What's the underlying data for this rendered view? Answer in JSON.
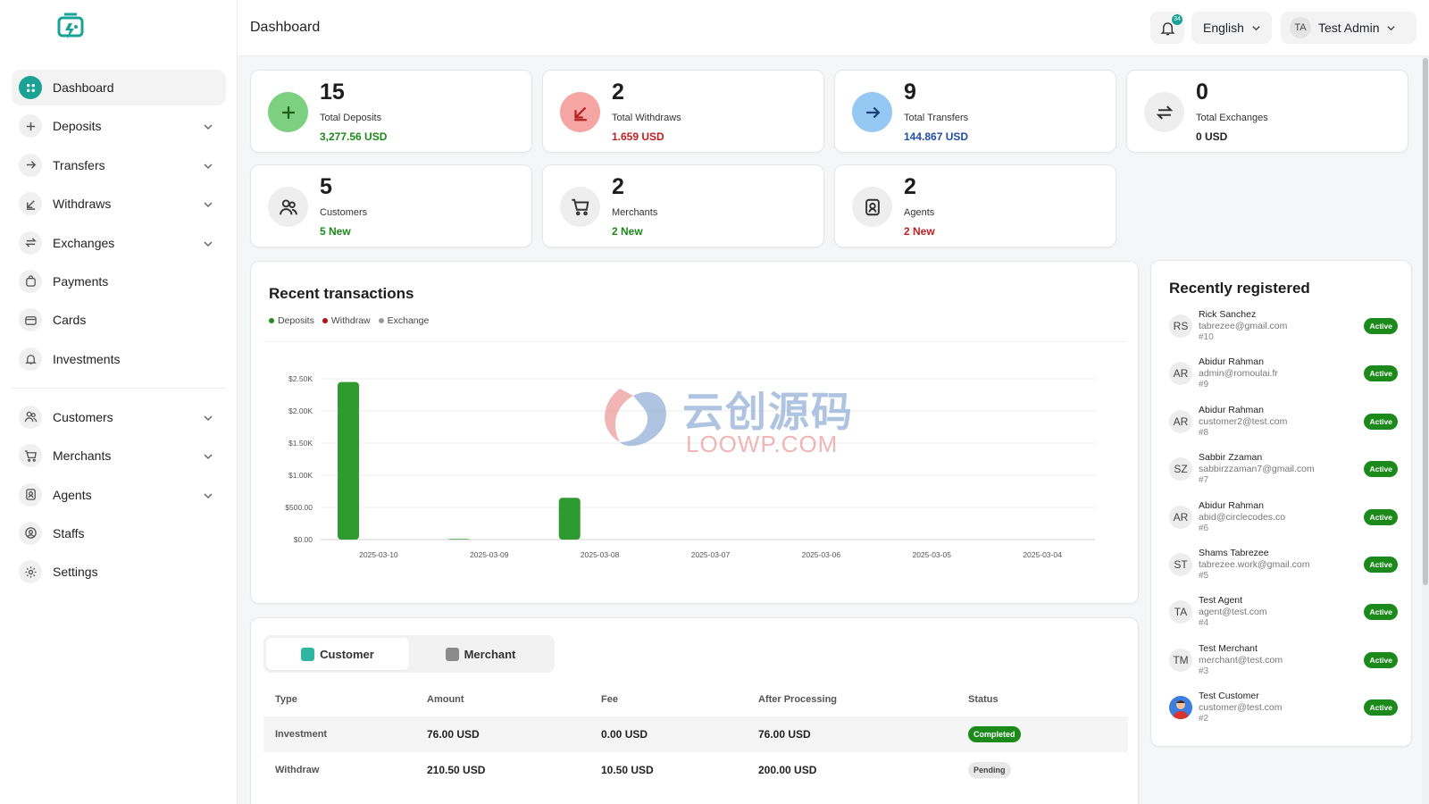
{
  "topbar": {
    "title": "Dashboard",
    "notifications_count": "34",
    "language": "English",
    "user_initials": "TA",
    "user_name": "Test Admin"
  },
  "sidebar": {
    "items": [
      {
        "label": "Dashboard",
        "icon": "grid-icon",
        "active": true
      },
      {
        "label": "Deposits",
        "icon": "plus-icon",
        "has_children": true
      },
      {
        "label": "Transfers",
        "icon": "arrow-right-icon",
        "has_children": true
      },
      {
        "label": "Withdraws",
        "icon": "arrow-down-left-icon",
        "has_children": true
      },
      {
        "label": "Exchanges",
        "icon": "exchange-icon",
        "has_children": true
      },
      {
        "label": "Payments",
        "icon": "bag-icon"
      },
      {
        "label": "Cards",
        "icon": "card-icon"
      },
      {
        "label": "Investments",
        "icon": "bell-icon"
      }
    ],
    "items2": [
      {
        "label": "Customers",
        "icon": "users-icon",
        "has_children": true
      },
      {
        "label": "Merchants",
        "icon": "cart-icon",
        "has_children": true
      },
      {
        "label": "Agents",
        "icon": "badge-icon",
        "has_children": true
      },
      {
        "label": "Staffs",
        "icon": "user-circle-icon"
      },
      {
        "label": "Settings",
        "icon": "gear-icon"
      }
    ]
  },
  "stats": [
    {
      "number": "15",
      "label": "Total Deposits",
      "sub": "3,277.56 USD",
      "sub_color": "#1b8a1b",
      "icon": "plus-icon",
      "icon_bg": "#7dd07f",
      "icon_color": "#1a5e1a"
    },
    {
      "number": "2",
      "label": "Total Withdraws",
      "sub": "1.659 USD",
      "sub_color": "#c0201f",
      "icon": "arrow-down-left-icon",
      "icon_bg": "#f6a5a5",
      "icon_color": "#b3201f"
    },
    {
      "number": "9",
      "label": "Total Transfers",
      "sub": "144.867 USD",
      "sub_color": "#1f4fa3",
      "icon": "arrow-right-icon",
      "icon_bg": "#95c8f3",
      "icon_color": "#1d3f7a"
    },
    {
      "number": "0",
      "label": "Total Exchanges",
      "sub": "0 USD",
      "sub_color": "#222222",
      "icon": "exchange-icon",
      "icon_bg": "#eeeeee",
      "icon_color": "#333333"
    },
    {
      "number": "5",
      "label": "Customers",
      "sub": "5 New",
      "sub_color": "#1b8a1b",
      "icon": "users-icon",
      "icon_bg": "#eeeeee",
      "icon_color": "#333333"
    },
    {
      "number": "2",
      "label": "Merchants",
      "sub": "2 New",
      "sub_color": "#1b8a1b",
      "icon": "cart-icon",
      "icon_bg": "#eeeeee",
      "icon_color": "#333333"
    },
    {
      "number": "2",
      "label": "Agents",
      "sub": "2 New",
      "sub_color": "#c0201f",
      "icon": "badge-icon",
      "icon_bg": "#eeeeee",
      "icon_color": "#333333"
    }
  ],
  "chart": {
    "title": "Recent transactions",
    "legend": [
      {
        "name": "Deposits",
        "color": "#1f8f1f"
      },
      {
        "name": "Withdraw",
        "color": "#b31212"
      },
      {
        "name": "Exchange",
        "color": "#9b9b9b"
      }
    ]
  },
  "chart_data": {
    "type": "bar",
    "title": "Recent transactions",
    "categories": [
      "2025-03-10",
      "2025-03-09",
      "2025-03-08",
      "2025-03-07",
      "2025-03-06",
      "2025-03-05",
      "2025-03-04"
    ],
    "series": [
      {
        "name": "Deposits",
        "color": "#2f9a2f",
        "values": [
          2450,
          10,
          650,
          0,
          0,
          0,
          0
        ]
      },
      {
        "name": "Withdraw",
        "color": "#b31212",
        "values": [
          0,
          0,
          0,
          0,
          0,
          0,
          0
        ]
      },
      {
        "name": "Exchange",
        "color": "#9b9b9b",
        "values": [
          0,
          0,
          0,
          0,
          0,
          0,
          0
        ]
      }
    ],
    "y_ticks": [
      "$0.00",
      "$500.00",
      "$1.00K",
      "$1.50K",
      "$2.00K",
      "$2.50K"
    ],
    "ylim": [
      0,
      2500
    ],
    "grid": true,
    "legend_position": "top-left"
  },
  "watermark": {
    "cn": "云创源码",
    "en": "LOOWP.COM"
  },
  "transactions": {
    "tabs": [
      {
        "label": "Customer",
        "active": true
      },
      {
        "label": "Merchant",
        "active": false
      }
    ],
    "columns": [
      "Type",
      "Amount",
      "Fee",
      "After Processing",
      "Status"
    ],
    "rows": [
      {
        "type": "Investment",
        "amount": "76.00 USD",
        "fee": "0.00 USD",
        "after": "76.00 USD",
        "status": "Completed"
      },
      {
        "type": "Withdraw",
        "amount": "210.50 USD",
        "fee": "10.50 USD",
        "after": "200.00 USD",
        "status": "Pending"
      }
    ]
  },
  "registered": {
    "title": "Recently registered",
    "items": [
      {
        "initials": "RS",
        "name": "Rick Sanchez",
        "email": "tabrezee@gmail.com",
        "id": "#10",
        "status": "Active"
      },
      {
        "initials": "AR",
        "name": "Abidur Rahman",
        "email": "admin@romoulai.fr",
        "id": "#9",
        "status": "Active"
      },
      {
        "initials": "AR",
        "name": "Abidur Rahman",
        "email": "customer2@test.com",
        "id": "#8",
        "status": "Active"
      },
      {
        "initials": "SZ",
        "name": "Sabbir Zzaman",
        "email": "sabbirzzaman7@gmail.com",
        "id": "#7",
        "status": "Active"
      },
      {
        "initials": "AR",
        "name": "Abidur Rahman",
        "email": "abid@circlecodes.co",
        "id": "#6",
        "status": "Active"
      },
      {
        "initials": "ST",
        "name": "Shams Tabrezee",
        "email": "tabrezee.work@gmail.com",
        "id": "#5",
        "status": "Active"
      },
      {
        "initials": "TA",
        "name": "Test Agent",
        "email": "agent@test.com",
        "id": "#4",
        "status": "Active"
      },
      {
        "initials": "TM",
        "name": "Test Merchant",
        "email": "merchant@test.com",
        "id": "#3",
        "status": "Active"
      },
      {
        "initials": "",
        "name": "Test Customer",
        "email": "customer@test.com",
        "id": "#2",
        "status": "Active",
        "photo": true
      }
    ]
  }
}
